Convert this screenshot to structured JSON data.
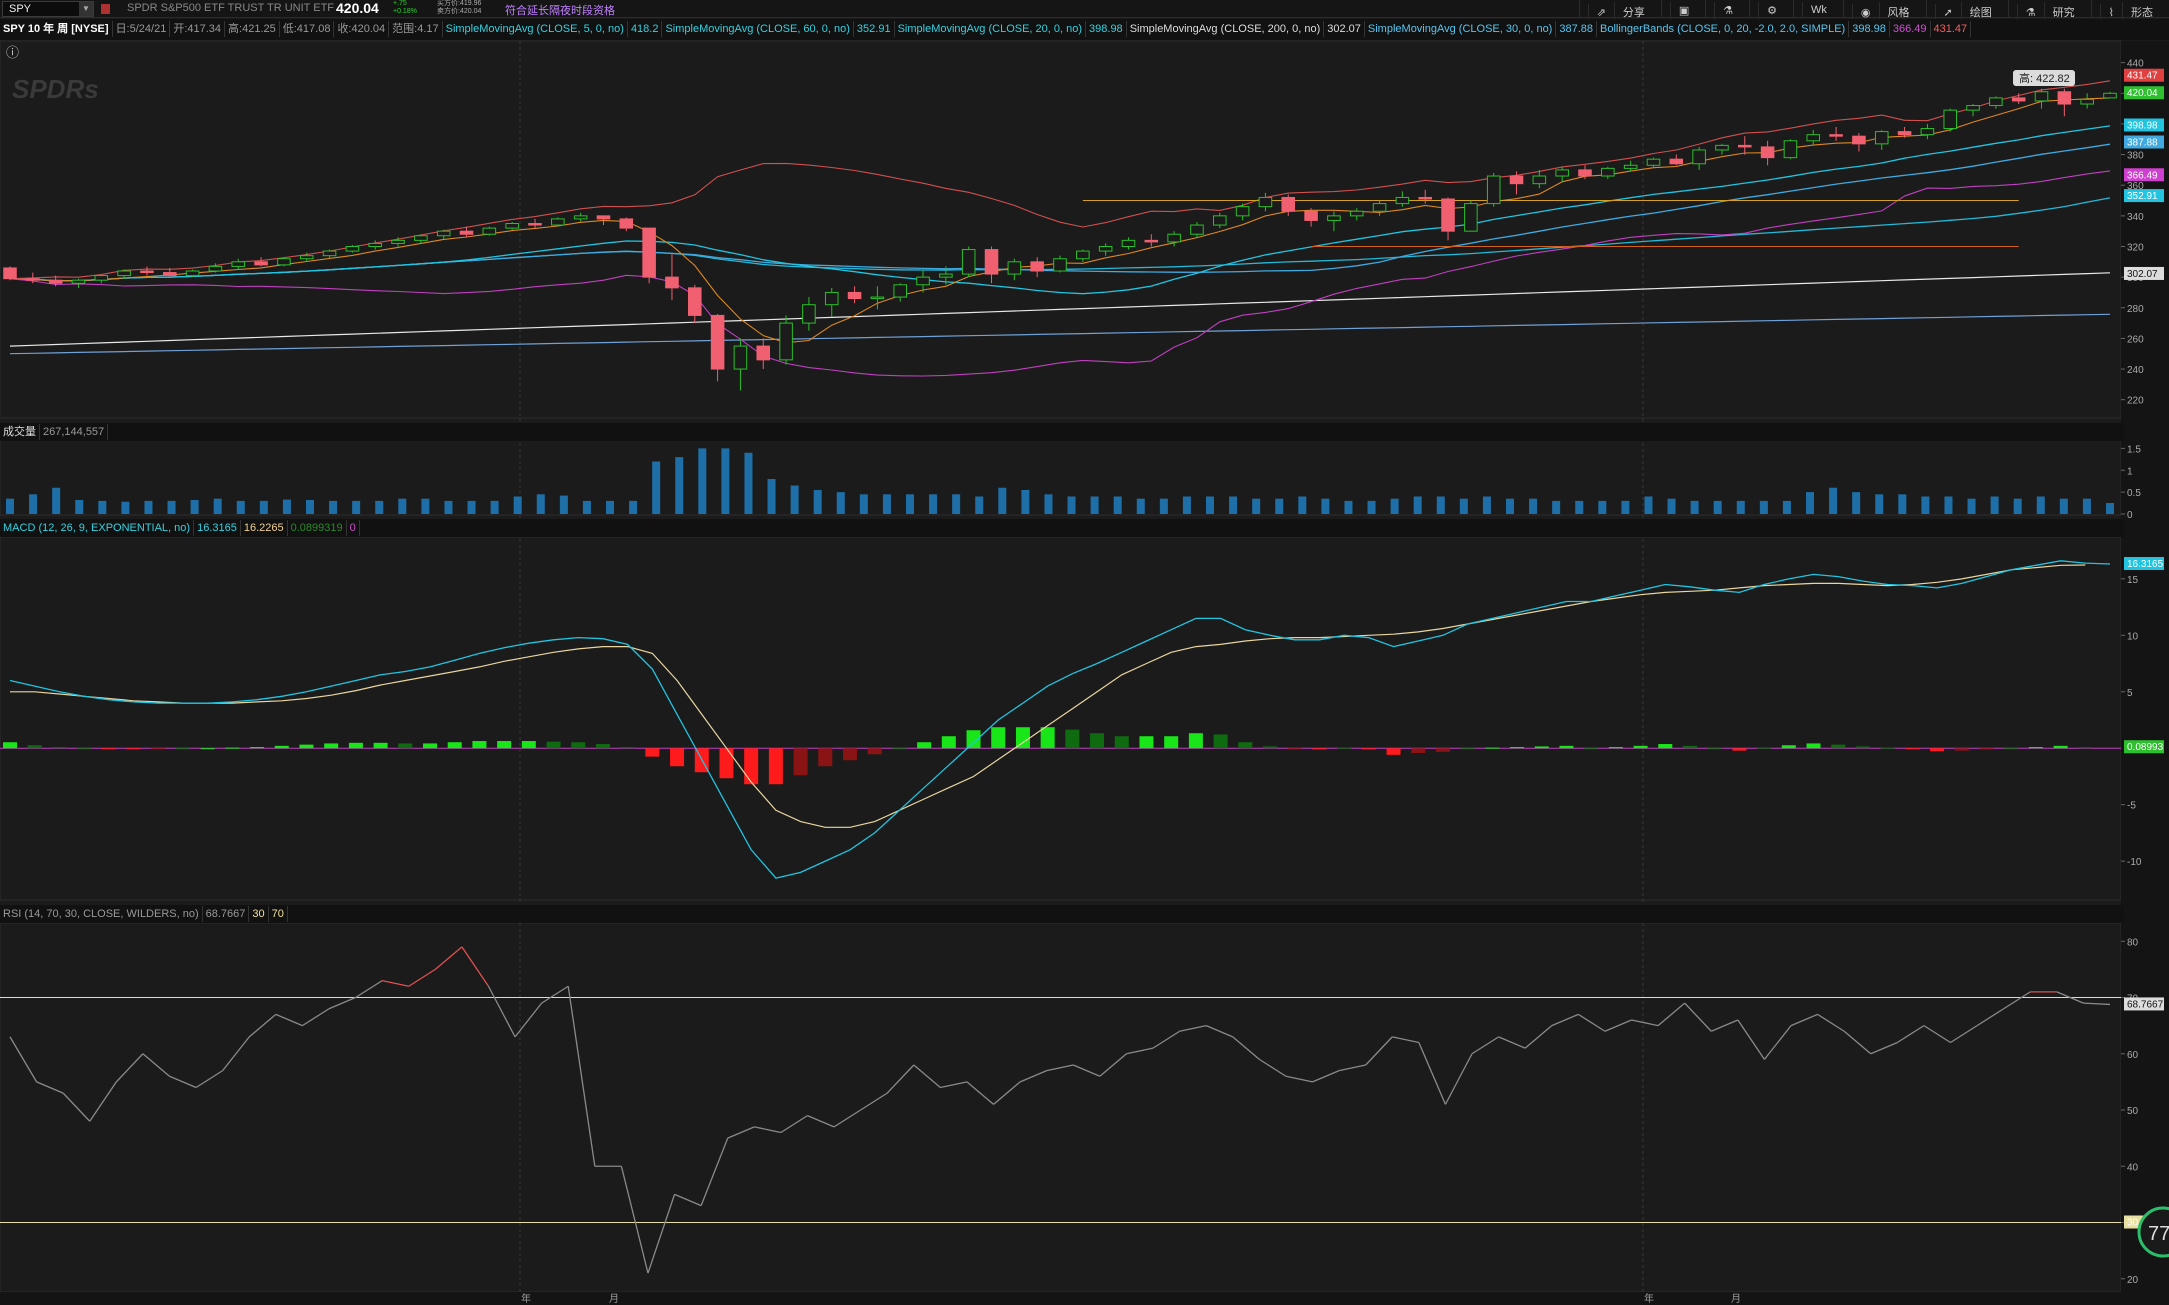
{
  "topbar": {
    "symbol": "SPY",
    "description": "SPDR S&P500 ETF TRUST TR UNIT ETF",
    "price": "420.04",
    "change_line1": "+.75",
    "change_line2": "+0.18%",
    "bid": "买方价:419.96",
    "ask": "卖方价:420.04",
    "extended": "符合延长隔夜时段资格",
    "tools": [
      "分享",
      "",
      "",
      "",
      "Wk",
      "风格",
      "绘图",
      "研究",
      "形态"
    ]
  },
  "studybar": {
    "title": "SPY 10 年 周 [NYSE]",
    "date": "日:5/24/21",
    "open": "开:417.34",
    "high": "高:421.25",
    "low": "低:417.08",
    "close": "收:420.04",
    "range": "范围:4.17",
    "studies": [
      {
        "name": "SimpleMovingAvg (CLOSE, 5, 0, no)",
        "value": "418.2",
        "color": "#35d1e0"
      },
      {
        "name": "SimpleMovingAvg (CLOSE, 60, 0, no)",
        "value": "352.91",
        "color": "#35d1e0"
      },
      {
        "name": "SimpleMovingAvg (CLOSE, 20, 0, no)",
        "value": "398.98",
        "color": "#35d1e0"
      },
      {
        "name": "SimpleMovingAvg (CLOSE, 200, 0, no)",
        "value": "302.07",
        "color": "#dddddd"
      },
      {
        "name": "SimpleMovingAvg (CLOSE, 30, 0, no)",
        "value": "387.88",
        "color": "#58c6f0"
      },
      {
        "name": "BollingerBands (CLOSE, 0, 20, -2.0, 2.0, SIMPLE)",
        "value": "398.98",
        "color": "#58c6f0"
      }
    ],
    "bb_lower": "366.49",
    "bb_upper": "431.47"
  },
  "price_panel": {
    "logo": "SPDRs",
    "high_tag": "高: 422.82",
    "axis_ticks": [
      "440",
      "420",
      "400",
      "380",
      "360",
      "340",
      "320",
      "300",
      "280",
      "260",
      "240",
      "220"
    ],
    "badges": [
      {
        "text": "431.47",
        "color": "#e04040"
      },
      {
        "text": "420.04",
        "color": "#2dbf2d"
      },
      {
        "text": "398.98",
        "color": "#22c4e0"
      },
      {
        "text": "387.88",
        "color": "#3fa9e0"
      },
      {
        "text": "366.49",
        "color": "#d040d0"
      },
      {
        "text": "352.91",
        "color": "#22c4e0"
      },
      {
        "text": "302.07",
        "color": "#dddddd"
      }
    ]
  },
  "volume_panel": {
    "label": "成交量",
    "value": "267,144,557",
    "axis_ticks": [
      "1.5",
      "1",
      "0.5",
      "0"
    ]
  },
  "macd_panel": {
    "label": "MACD (12, 26, 9, EXPONENTIAL, no)",
    "value": "16.3165",
    "avg": "16.2265",
    "diff": "0.0899319",
    "zero": "0",
    "axis_ticks": [
      "15",
      "10",
      "5",
      "-5",
      "-10"
    ],
    "badges": [
      {
        "text": "16.3165",
        "color": "#22c4e0"
      },
      {
        "text": "0.08993",
        "color": "#2dbf2d"
      }
    ]
  },
  "rsi_panel": {
    "label": "RSI (14, 70, 30, CLOSE, WILDERS, no)",
    "value": "68.7667",
    "over_sold": "30",
    "over_bought": "70",
    "axis_ticks": [
      "80",
      "70",
      "60",
      "50",
      "40",
      "30",
      "20"
    ],
    "badge": "68.7667",
    "badge_os": "30"
  },
  "xaxis": {
    "labels": [
      "年",
      "月",
      "年",
      "月"
    ]
  },
  "bubble": "77",
  "chart_data": {
    "type": "candlestick",
    "price": {
      "bars": [
        [
          306,
          307,
          298,
          299
        ],
        [
          299,
          303,
          296,
          298
        ],
        [
          298,
          301,
          294,
          296
        ],
        [
          296,
          299,
          293,
          298
        ],
        [
          298,
          302,
          296,
          301
        ],
        [
          301,
          305,
          299,
          304
        ],
        [
          304,
          307,
          301,
          303
        ],
        [
          303,
          306,
          300,
          301
        ],
        [
          301,
          305,
          300,
          304
        ],
        [
          304,
          309,
          303,
          307
        ],
        [
          307,
          312,
          305,
          310
        ],
        [
          310,
          313,
          307,
          308
        ],
        [
          308,
          313,
          307,
          312
        ],
        [
          312,
          316,
          310,
          314
        ],
        [
          314,
          318,
          312,
          317
        ],
        [
          317,
          321,
          316,
          320
        ],
        [
          320,
          324,
          318,
          322
        ],
        [
          322,
          326,
          320,
          324
        ],
        [
          324,
          328,
          322,
          327
        ],
        [
          327,
          331,
          325,
          330
        ],
        [
          330,
          333,
          326,
          328
        ],
        [
          328,
          333,
          327,
          332
        ],
        [
          332,
          336,
          331,
          335
        ],
        [
          335,
          338,
          332,
          334
        ],
        [
          334,
          339,
          333,
          338
        ],
        [
          338,
          342,
          336,
          340
        ],
        [
          340,
          339,
          334,
          338
        ],
        [
          338,
          339,
          330,
          332
        ],
        [
          332,
          322,
          296,
          300
        ],
        [
          300,
          315,
          285,
          293
        ],
        [
          293,
          295,
          270,
          275
        ],
        [
          275,
          276,
          232,
          240
        ],
        [
          240,
          260,
          226,
          255
        ],
        [
          255,
          260,
          240,
          246
        ],
        [
          246,
          275,
          243,
          270
        ],
        [
          270,
          287,
          265,
          282
        ],
        [
          282,
          293,
          274,
          290
        ],
        [
          290,
          294,
          283,
          286
        ],
        [
          286,
          294,
          279,
          287
        ],
        [
          287,
          296,
          284,
          295
        ],
        [
          295,
          305,
          290,
          300
        ],
        [
          300,
          307,
          295,
          302
        ],
        [
          302,
          320,
          300,
          318
        ],
        [
          318,
          320,
          296,
          302
        ],
        [
          302,
          312,
          298,
          310
        ],
        [
          310,
          313,
          300,
          304
        ],
        [
          304,
          314,
          303,
          312
        ],
        [
          312,
          318,
          310,
          317
        ],
        [
          317,
          322,
          314,
          320
        ],
        [
          320,
          326,
          318,
          324
        ],
        [
          324,
          328,
          320,
          323
        ],
        [
          323,
          330,
          320,
          328
        ],
        [
          328,
          336,
          326,
          334
        ],
        [
          334,
          342,
          332,
          340
        ],
        [
          340,
          348,
          337,
          346
        ],
        [
          346,
          355,
          343,
          352
        ],
        [
          352,
          354,
          340,
          343
        ],
        [
          343,
          345,
          333,
          337
        ],
        [
          337,
          343,
          330,
          340
        ],
        [
          340,
          345,
          337,
          343
        ],
        [
          343,
          350,
          340,
          348
        ],
        [
          348,
          356,
          346,
          352
        ],
        [
          352,
          357,
          348,
          351
        ],
        [
          351,
          352,
          324,
          330
        ],
        [
          330,
          350,
          330,
          348
        ],
        [
          348,
          368,
          346,
          366
        ],
        [
          366,
          369,
          354,
          361
        ],
        [
          361,
          370,
          358,
          366
        ],
        [
          366,
          372,
          362,
          370
        ],
        [
          370,
          373,
          364,
          366
        ],
        [
          366,
          372,
          364,
          371
        ],
        [
          371,
          376,
          369,
          373
        ],
        [
          373,
          378,
          371,
          377
        ],
        [
          377,
          380,
          373,
          374
        ],
        [
          374,
          385,
          370,
          383
        ],
        [
          383,
          387,
          380,
          386
        ],
        [
          386,
          392,
          380,
          385
        ],
        [
          385,
          389,
          373,
          378
        ],
        [
          378,
          390,
          377,
          389
        ],
        [
          389,
          396,
          386,
          393
        ],
        [
          393,
          398,
          389,
          392
        ],
        [
          392,
          394,
          382,
          387
        ],
        [
          387,
          396,
          383,
          395
        ],
        [
          395,
          398,
          391,
          393
        ],
        [
          393,
          400,
          390,
          397
        ],
        [
          397,
          410,
          395,
          409
        ],
        [
          409,
          413,
          405,
          412
        ],
        [
          412,
          418,
          410,
          417
        ],
        [
          417,
          420,
          413,
          415
        ],
        [
          415,
          423,
          410,
          421
        ],
        [
          421,
          423,
          405,
          413
        ],
        [
          413,
          420,
          410,
          416
        ],
        [
          417,
          421,
          417,
          420
        ]
      ],
      "sma5": "418.2",
      "sma20": "398.98",
      "sma30": "387.88",
      "sma60": "352.91",
      "sma200": "302.07"
    },
    "macd": {
      "macd": [
        6,
        5.5,
        5,
        4.6,
        4.3,
        4.1,
        4,
        4,
        4,
        4.1,
        4.3,
        4.6,
        5,
        5.5,
        6,
        6.5,
        6.8,
        7.2,
        7.8,
        8.4,
        8.9,
        9.3,
        9.6,
        9.8,
        9.7,
        9.2,
        7,
        3,
        -1,
        -5,
        -9,
        -11.5,
        -11,
        -10,
        -9,
        -7.5,
        -5.5,
        -3.5,
        -1.5,
        0.5,
        2.5,
        4,
        5.5,
        6.6,
        7.5,
        8.5,
        9.5,
        10.5,
        11.5,
        11.5,
        10.5,
        10,
        9.6,
        9.6,
        10,
        9.8,
        9,
        9.5,
        10,
        11,
        11.5,
        12,
        12.5,
        13,
        13,
        13.5,
        14,
        14.5,
        14.3,
        14,
        13.8,
        14.5,
        15,
        15.4,
        15.2,
        14.8,
        14.5,
        14.4,
        14.2,
        14.6,
        15.2,
        15.8,
        16.2,
        16.6,
        16.4,
        16.3165
      ],
      "signal": [
        5,
        5,
        4.8,
        4.6,
        4.4,
        4.2,
        4.1,
        4,
        4,
        4,
        4.1,
        4.2,
        4.4,
        4.7,
        5.1,
        5.6,
        6,
        6.4,
        6.8,
        7.2,
        7.7,
        8.1,
        8.5,
        8.8,
        9,
        9,
        8.4,
        6,
        3,
        0,
        -3,
        -5.5,
        -6.5,
        -7,
        -7,
        -6.5,
        -5.5,
        -4.5,
        -3.5,
        -2.5,
        -1,
        0.5,
        2,
        3.5,
        5,
        6.5,
        7.5,
        8.5,
        9,
        9.2,
        9.5,
        9.7,
        9.8,
        9.8,
        9.9,
        10,
        10.1,
        10.3,
        10.6,
        11,
        11.4,
        11.8,
        12.2,
        12.6,
        13,
        13.3,
        13.6,
        13.8,
        13.9,
        14,
        14.2,
        14.4,
        14.5,
        14.6,
        14.6,
        14.5,
        14.4,
        14.5,
        14.7,
        15,
        15.4,
        15.8,
        16,
        16.2,
        16.2265
      ]
    },
    "rsi": [
      63,
      55,
      53,
      48,
      55,
      60,
      56,
      54,
      57,
      63,
      67,
      65,
      68,
      70,
      73,
      72,
      75,
      79,
      72,
      63,
      69,
      72,
      40,
      40,
      21,
      35,
      33,
      45,
      47,
      46,
      49,
      47,
      50,
      53,
      58,
      54,
      55,
      51,
      55,
      57,
      58,
      56,
      60,
      61,
      64,
      65,
      63,
      59,
      56,
      55,
      57,
      58,
      63,
      62,
      51,
      60,
      63,
      61,
      65,
      67,
      64,
      66,
      65,
      69,
      64,
      66,
      59,
      65,
      67,
      64,
      60,
      62,
      65,
      62,
      65,
      68,
      71,
      71,
      69,
      68.7667
    ],
    "volume": [
      0.35,
      0.45,
      0.6,
      0.32,
      0.3,
      0.28,
      0.3,
      0.3,
      0.32,
      0.35,
      0.3,
      0.3,
      0.33,
      0.32,
      0.3,
      0.3,
      0.3,
      0.35,
      0.35,
      0.3,
      0.3,
      0.3,
      0.4,
      0.45,
      0.42,
      0.3,
      0.3,
      0.3,
      1.2,
      1.3,
      1.5,
      1.5,
      1.4,
      0.8,
      0.65,
      0.55,
      0.5,
      0.45,
      0.45,
      0.45,
      0.45,
      0.45,
      0.4,
      0.6,
      0.55,
      0.45,
      0.4,
      0.4,
      0.4,
      0.35,
      0.35,
      0.4,
      0.4,
      0.4,
      0.35,
      0.35,
      0.4,
      0.35,
      0.3,
      0.3,
      0.35,
      0.4,
      0.4,
      0.35,
      0.4,
      0.35,
      0.35,
      0.3,
      0.3,
      0.3,
      0.3,
      0.4,
      0.35,
      0.3,
      0.3,
      0.3,
      0.3,
      0.3,
      0.5,
      0.6,
      0.5,
      0.45,
      0.45,
      0.4,
      0.4,
      0.35,
      0.4,
      0.35,
      0.4,
      0.35,
      0.35,
      0.25
    ]
  }
}
